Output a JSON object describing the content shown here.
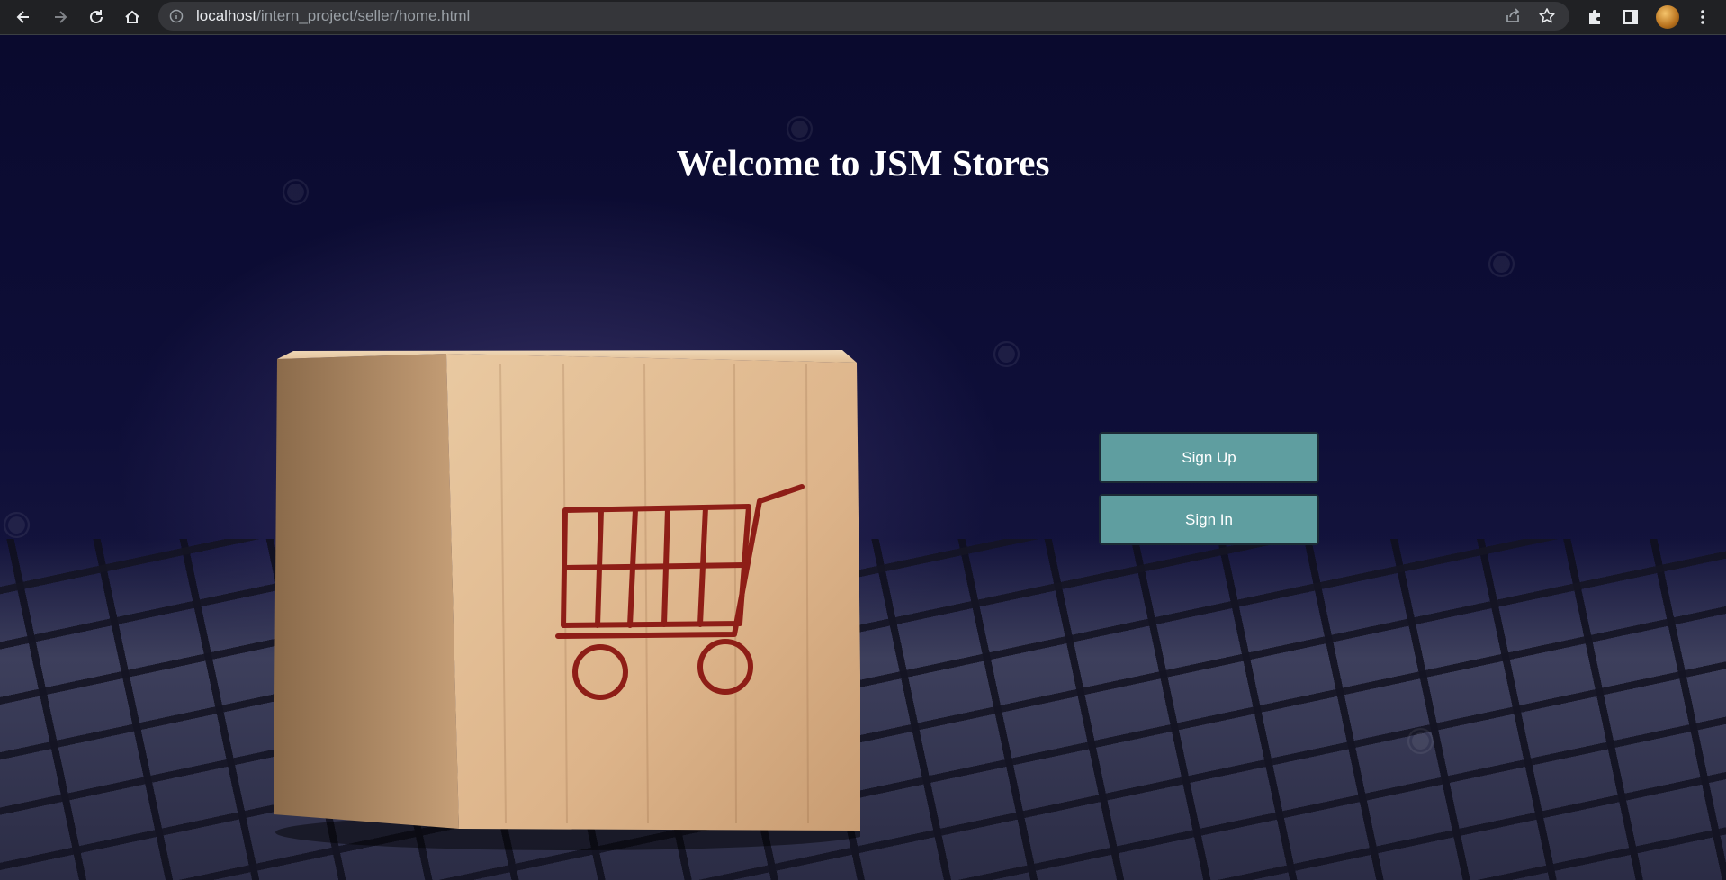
{
  "browser": {
    "url_host": "localhost",
    "url_path": "/intern_project/seller/home.html"
  },
  "page": {
    "title": "Welcome to JSM Stores",
    "buttons": {
      "sign_up": "Sign Up",
      "sign_in": "Sign In"
    }
  },
  "colors": {
    "button_bg": "#5f9ea0",
    "background": "#0b0b2a"
  },
  "icons": [
    "back-icon",
    "forward-icon",
    "reload-icon",
    "home-icon",
    "info-icon",
    "share-icon",
    "star-icon",
    "extensions-icon",
    "side-panel-icon",
    "menu-icon",
    "shopping-cart-icon"
  ]
}
